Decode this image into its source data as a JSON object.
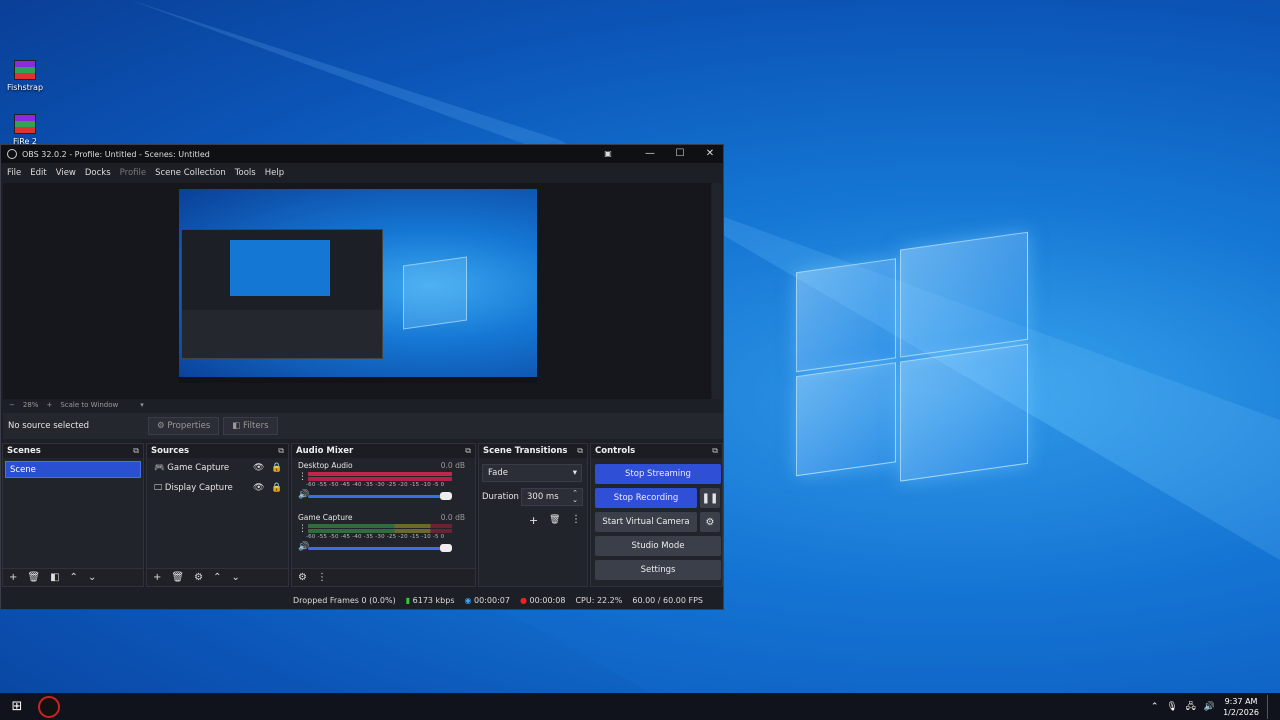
{
  "desktop": {
    "icons": [
      {
        "label": "Fishstrap",
        "icon": "winrar-icon"
      },
      {
        "label": "FiRe 2",
        "icon": "winrar-icon"
      }
    ]
  },
  "window": {
    "title": "OBS 32.0.2 - Profile: Untitled - Scenes: Untitled",
    "controls": {
      "minimize": "—",
      "maximize": "☐",
      "close": "✕"
    }
  },
  "menu": [
    "File",
    "Edit",
    "View",
    "Docks",
    "Profile",
    "Scene Collection",
    "Tools",
    "Help"
  ],
  "preview": {
    "zoom": "28%",
    "scale_mode": "Scale to Window"
  },
  "source_toolbar": {
    "status": "No source selected",
    "properties": "Properties",
    "filters": "Filters"
  },
  "scenes": {
    "title": "Scenes",
    "items": [
      "Scene"
    ]
  },
  "sources": {
    "title": "Sources",
    "items": [
      {
        "name": "Game Capture",
        "icon": "gamepad-icon"
      },
      {
        "name": "Display Capture",
        "icon": "monitor-icon"
      }
    ]
  },
  "mixer": {
    "title": "Audio Mixer",
    "channels": [
      {
        "name": "Desktop Audio",
        "db": "0.0 dB"
      },
      {
        "name": "Game Capture",
        "db": "0.0 dB"
      }
    ],
    "scale": "-60 -55 -50 -45 -40 -35 -30 -25 -20 -15 -10 -5 0"
  },
  "transitions": {
    "title": "Scene Transitions",
    "selected": "Fade",
    "duration_label": "Duration",
    "duration": "300 ms"
  },
  "controls": {
    "title": "Controls",
    "stop_streaming": "Stop Streaming",
    "stop_recording": "Stop Recording",
    "virtual_camera": "Start Virtual Camera",
    "studio_mode": "Studio Mode",
    "settings": "Settings"
  },
  "status": {
    "dropped": "Dropped Frames 0 (0.0%)",
    "bitrate": "6173 kbps",
    "stream_time": "00:00:07",
    "record_time": "00:00:08",
    "cpu": "CPU: 22.2%",
    "fps": "60.00 / 60.00 FPS"
  },
  "taskbar": {
    "time": "9:37 AM",
    "date": "1/2/2026"
  },
  "colors": {
    "accent": "#2f4fd6",
    "window_bg": "#1d1f26",
    "desktop": "#1577d4"
  }
}
